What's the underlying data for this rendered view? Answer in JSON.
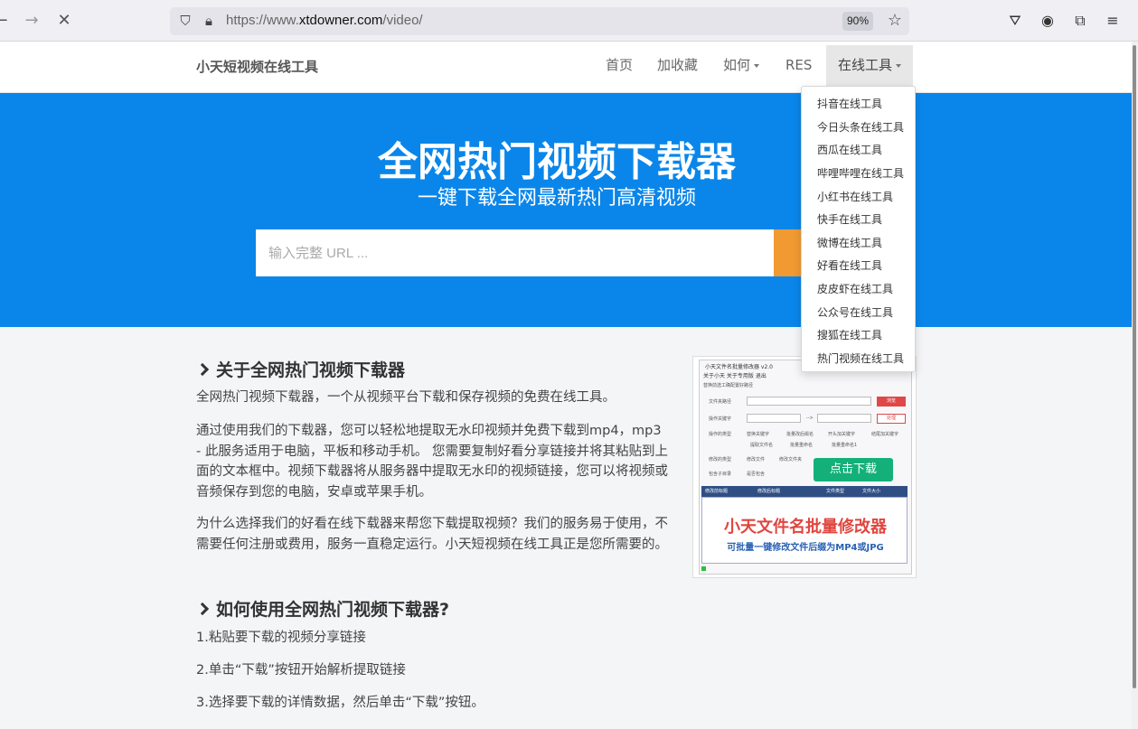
{
  "browser": {
    "url_prefix": "https://www.",
    "url_host": "xtdowner.com",
    "url_path": "/video/",
    "zoom": "90%"
  },
  "navbar": {
    "brand": "小天短视频在线工具",
    "links": [
      "首页",
      "加收藏",
      "如何",
      "RES",
      "在线工具"
    ]
  },
  "dropdown": {
    "items": [
      "抖音在线工具",
      "今日头条在线工具",
      "西瓜在线工具",
      "哔哩哔哩在线工具",
      "小红书在线工具",
      "快手在线工具",
      "微博在线工具",
      "好看在线工具",
      "皮皮虾在线工具",
      "公众号在线工具",
      "搜狐在线工具",
      "热门视频在线工具"
    ]
  },
  "hero": {
    "title": "全网热门视频下载器",
    "subtitle": "一键下载全网最新热门高清视频",
    "placeholder": "输入完整 URL ..."
  },
  "about": {
    "title": "关于全网热门视频下载器",
    "p1": "全网热门视频下载器，一个从视频平台下载和保存视频的免费在线工具。",
    "p2": "通过使用我们的下载器，您可以轻松地提取无水印视频并免费下载到mp4，mp3 - 此服务适用于电脑，平板和移动手机。 您需要复制好看分享链接并将其粘贴到上面的文本框中。视频下载器将从服务器中提取无水印的视频链接，您可以将视频或音频保存到您的电脑，安卓或苹果手机。",
    "p3": "为什么选择我们的好看在线下载器来帮您下载提取视频？我们的服务易于使用，不需要任何注册或费用，服务一直稳定运行。小天短视频在线工具正是您所需要的。"
  },
  "howto": {
    "title": "如何使用全网热门视频下载器?",
    "steps": [
      "1.粘贴要下载的视频分享链接",
      "2.单击“下载”按钮开始解析提取链接",
      "3.选择要下载的详情数据，然后单击“下载”按钮。"
    ]
  },
  "promo": {
    "window_title": "小天文件名批量修改器 v2.0",
    "menu": "关于小天    关于专用版    退出",
    "group": "替换前选工确配置好路径",
    "row1": "文件夹路径",
    "row2": "操作关键字",
    "row3": "操作的类型",
    "row4": "修改的类型",
    "row5": "包含子目录",
    "btn_browse": "浏览",
    "btn_process": "处理",
    "opt1": "替换关键字",
    "opt2": "批量改后缀名",
    "opt3": "开头加关键字",
    "opt4": "结尾加关键字",
    "opt5": "提取文件名",
    "opt6": "批量重命名",
    "opt7": "批量重命名1",
    "mod1": "修改文件",
    "mod2": "修改文件夹",
    "sub": "是否包含",
    "arrow": "-->",
    "download": "点击下载",
    "th1": "修改前标题",
    "th2": "修改后标题",
    "th3": "文件类型",
    "th4": "文件大小",
    "headline": "小天文件名批量修改器",
    "tagline": "可批量一键修改文件后缀为MP4或JPG"
  }
}
